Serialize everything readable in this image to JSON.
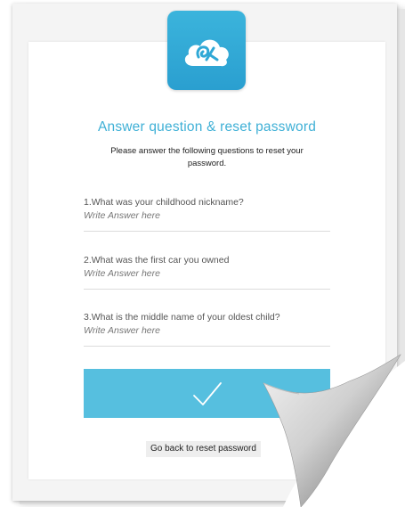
{
  "logo": {
    "icon": "cloud-logo-icon",
    "color": "#2fa8d6"
  },
  "header": {
    "title": "Answer question & reset password",
    "subtitle": "Please answer the following questions to reset your password."
  },
  "questions": [
    {
      "label": "1.What was your childhood nickname?",
      "placeholder": "Write Answer here"
    },
    {
      "label": "2.What was the first car you owned",
      "placeholder": "Write Answer here"
    },
    {
      "label": "3.What is the middle name of your oldest child?",
      "placeholder": "Write Answer here"
    }
  ],
  "submit": {
    "icon": "checkmark-icon",
    "color": "#56bfdf"
  },
  "back_link": {
    "label": "Go back to reset password"
  }
}
